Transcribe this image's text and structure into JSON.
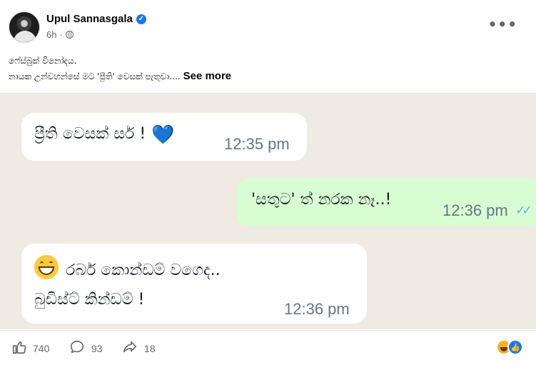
{
  "post": {
    "author": "Upul Sannasgala",
    "time": "6h",
    "verified_icon": "verified-badge-icon",
    "privacy_icon": "globe-icon",
    "more_label": "•••",
    "caption_line1": "ෆේස්බුක් විනෝදය.",
    "caption_line2": "නායක උන්වහන්සේ මට 'ප්‍රීති' වෙසක් පැතුවා....",
    "see_more": "See more"
  },
  "chat": {
    "background": "#efeae2",
    "messages": [
      {
        "direction": "in",
        "text": "ප්‍රීති වෙසක් සර් !",
        "emoji": "💙",
        "time": "12:35 pm"
      },
      {
        "direction": "out",
        "text": "'සතුට' ත් නරක නෑ..!",
        "time": "12:36 pm",
        "status": "read"
      },
      {
        "direction": "in",
        "emoji": "grinning-face",
        "line1": "රබර් කොන්ඩම් වගෙද..",
        "line2": "බුඩිස්ට් කින්ඩම් !",
        "time": "12:36 pm"
      }
    ]
  },
  "actions": {
    "likes": "740",
    "comments": "93",
    "shares": "18",
    "like_icon": "thumbs-up-icon",
    "comment_icon": "comment-icon",
    "share_icon": "share-icon",
    "reactions": [
      "haha",
      "like"
    ]
  }
}
